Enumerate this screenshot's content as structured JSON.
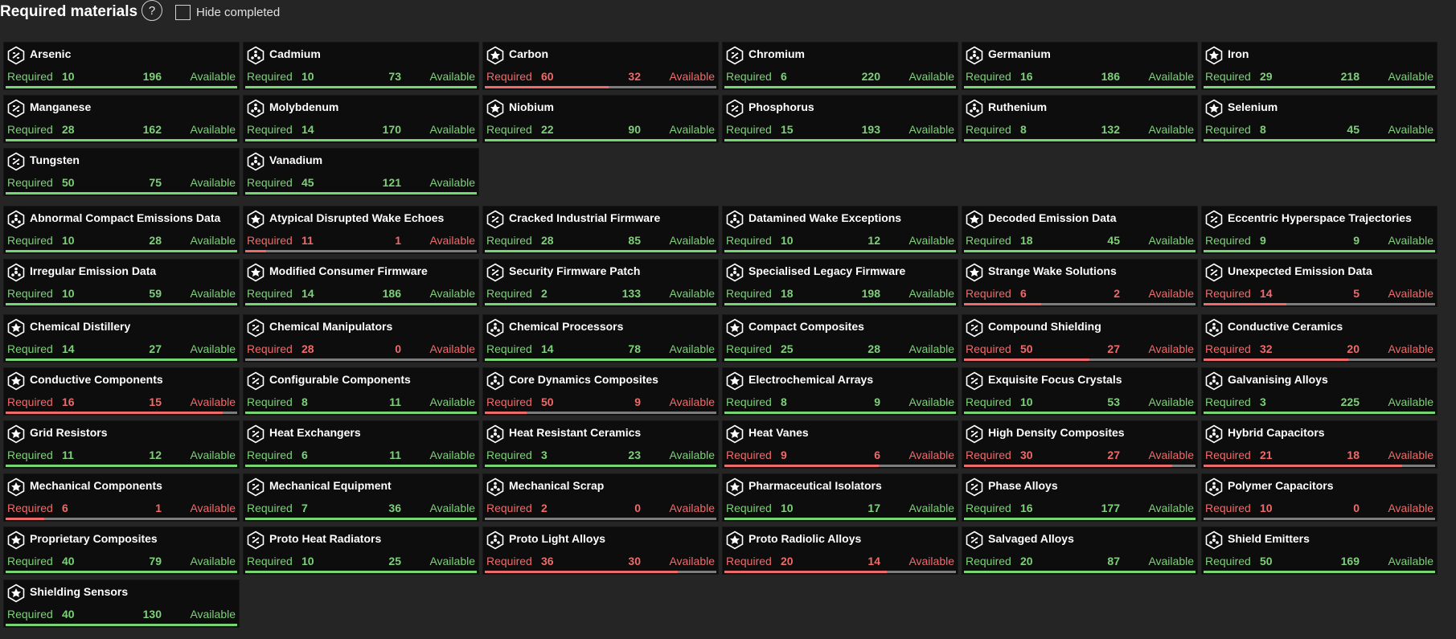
{
  "header": {
    "title": "Required materials",
    "help_icon": "?",
    "hide_completed_label": "Hide completed",
    "hide_completed_checked": false
  },
  "labels": {
    "required": "Required",
    "available": "Available"
  },
  "colors": {
    "ok": "#7ed07a",
    "bad": "#ee6b6b",
    "card_bg": "#0d0d0d",
    "page_bg": "#252525"
  },
  "sections": [
    {
      "name": "raw",
      "items": [
        {
          "name": "Arsenic",
          "required": 10,
          "available": 196
        },
        {
          "name": "Cadmium",
          "required": 10,
          "available": 73
        },
        {
          "name": "Carbon",
          "required": 60,
          "available": 32
        },
        {
          "name": "Chromium",
          "required": 6,
          "available": 220
        },
        {
          "name": "Germanium",
          "required": 16,
          "available": 186
        },
        {
          "name": "Iron",
          "required": 29,
          "available": 218
        },
        {
          "name": "Manganese",
          "required": 28,
          "available": 162
        },
        {
          "name": "Molybdenum",
          "required": 14,
          "available": 170
        },
        {
          "name": "Niobium",
          "required": 22,
          "available": 90
        },
        {
          "name": "Phosphorus",
          "required": 15,
          "available": 193
        },
        {
          "name": "Ruthenium",
          "required": 8,
          "available": 132
        },
        {
          "name": "Selenium",
          "required": 8,
          "available": 45
        },
        {
          "name": "Tungsten",
          "required": 50,
          "available": 75
        },
        {
          "name": "Vanadium",
          "required": 45,
          "available": 121
        }
      ]
    },
    {
      "name": "encoded",
      "items": [
        {
          "name": "Abnormal Compact Emissions Data",
          "required": 10,
          "available": 28
        },
        {
          "name": "Atypical Disrupted Wake Echoes",
          "required": 11,
          "available": 1
        },
        {
          "name": "Cracked Industrial Firmware",
          "required": 28,
          "available": 85
        },
        {
          "name": "Datamined Wake Exceptions",
          "required": 10,
          "available": 12
        },
        {
          "name": "Decoded Emission Data",
          "required": 18,
          "available": 45
        },
        {
          "name": "Eccentric Hyperspace Trajectories",
          "required": 9,
          "available": 9
        },
        {
          "name": "Irregular Emission Data",
          "required": 10,
          "available": 59
        },
        {
          "name": "Modified Consumer Firmware",
          "required": 14,
          "available": 186
        },
        {
          "name": "Security Firmware Patch",
          "required": 2,
          "available": 133
        },
        {
          "name": "Specialised Legacy Firmware",
          "required": 18,
          "available": 198
        },
        {
          "name": "Strange Wake Solutions",
          "required": 6,
          "available": 2
        },
        {
          "name": "Unexpected Emission Data",
          "required": 14,
          "available": 5
        }
      ]
    },
    {
      "name": "manufactured",
      "items": [
        {
          "name": "Chemical Distillery",
          "required": 14,
          "available": 27
        },
        {
          "name": "Chemical Manipulators",
          "required": 28,
          "available": 0
        },
        {
          "name": "Chemical Processors",
          "required": 14,
          "available": 78
        },
        {
          "name": "Compact Composites",
          "required": 25,
          "available": 28
        },
        {
          "name": "Compound Shielding",
          "required": 50,
          "available": 27
        },
        {
          "name": "Conductive Ceramics",
          "required": 32,
          "available": 20
        },
        {
          "name": "Conductive Components",
          "required": 16,
          "available": 15
        },
        {
          "name": "Configurable Components",
          "required": 8,
          "available": 11
        },
        {
          "name": "Core Dynamics Composites",
          "required": 50,
          "available": 9
        },
        {
          "name": "Electrochemical Arrays",
          "required": 8,
          "available": 9
        },
        {
          "name": "Exquisite Focus Crystals",
          "required": 10,
          "available": 53
        },
        {
          "name": "Galvanising Alloys",
          "required": 3,
          "available": 225
        },
        {
          "name": "Grid Resistors",
          "required": 11,
          "available": 12
        },
        {
          "name": "Heat Exchangers",
          "required": 6,
          "available": 11
        },
        {
          "name": "Heat Resistant Ceramics",
          "required": 3,
          "available": 23
        },
        {
          "name": "Heat Vanes",
          "required": 9,
          "available": 6
        },
        {
          "name": "High Density Composites",
          "required": 30,
          "available": 27
        },
        {
          "name": "Hybrid Capacitors",
          "required": 21,
          "available": 18
        },
        {
          "name": "Mechanical Components",
          "required": 6,
          "available": 1
        },
        {
          "name": "Mechanical Equipment",
          "required": 7,
          "available": 36
        },
        {
          "name": "Mechanical Scrap",
          "required": 2,
          "available": 0
        },
        {
          "name": "Pharmaceutical Isolators",
          "required": 10,
          "available": 17
        },
        {
          "name": "Phase Alloys",
          "required": 16,
          "available": 177
        },
        {
          "name": "Polymer Capacitors",
          "required": 10,
          "available": 0
        },
        {
          "name": "Proprietary Composites",
          "required": 40,
          "available": 79
        },
        {
          "name": "Proto Heat Radiators",
          "required": 10,
          "available": 25
        },
        {
          "name": "Proto Light Alloys",
          "required": 36,
          "available": 30
        },
        {
          "name": "Proto Radiolic Alloys",
          "required": 20,
          "available": 14
        },
        {
          "name": "Salvaged Alloys",
          "required": 20,
          "available": 87
        },
        {
          "name": "Shield Emitters",
          "required": 50,
          "available": 169
        },
        {
          "name": "Shielding Sensors",
          "required": 40,
          "available": 130
        }
      ]
    }
  ]
}
